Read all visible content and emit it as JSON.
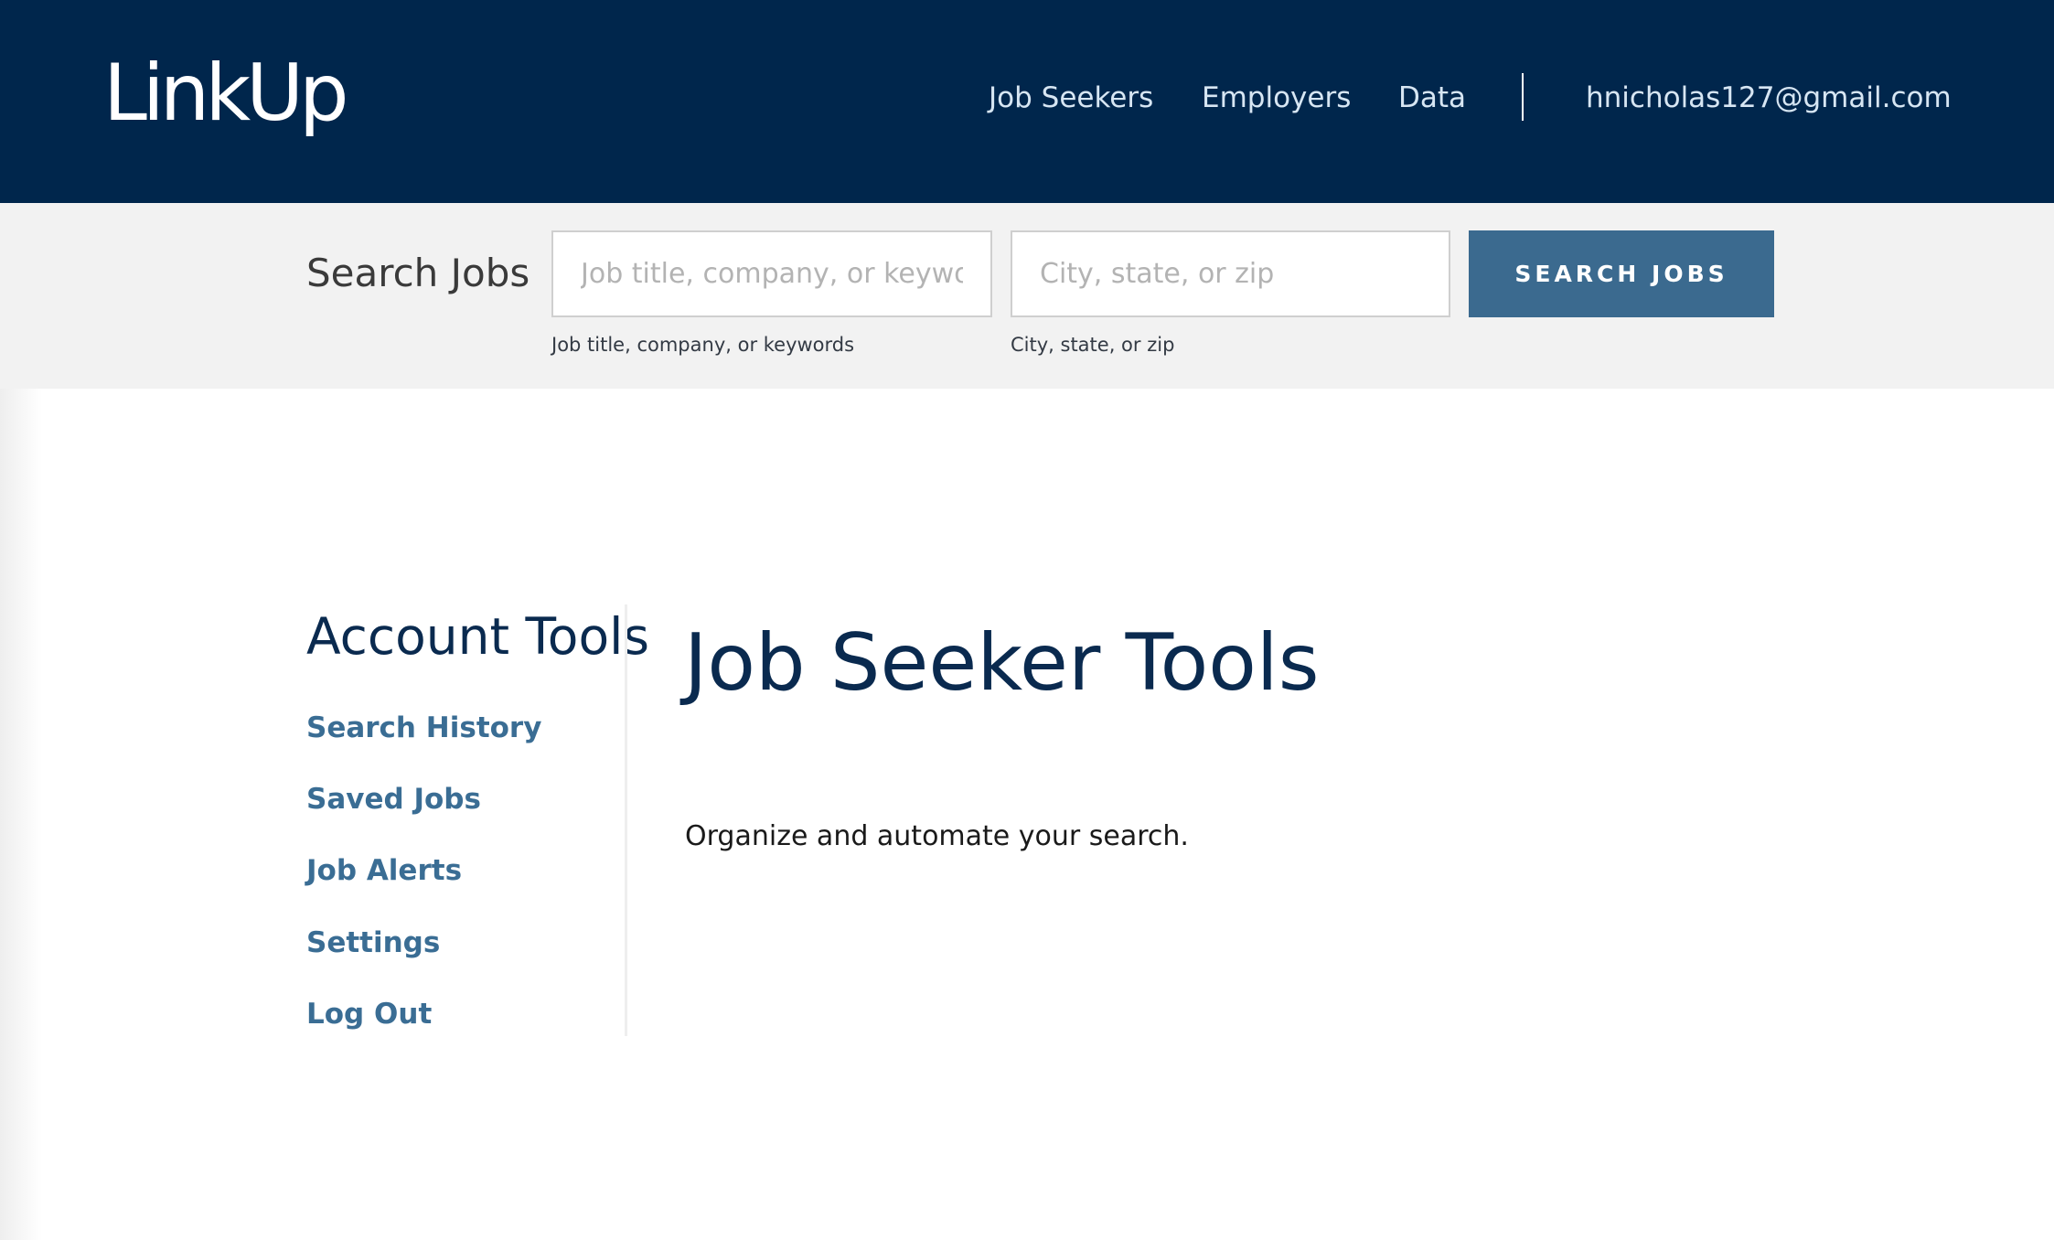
{
  "header": {
    "logo_text": "LinkUp",
    "nav": {
      "job_seekers": "Job Seekers",
      "employers": "Employers",
      "data": "Data"
    },
    "user_email": "hnicholas127@gmail.com"
  },
  "search": {
    "title": "Search Jobs",
    "keyword_field": {
      "placeholder": "Job title, company, or keywords",
      "caption": "Job title, company, or keywords"
    },
    "location_field": {
      "placeholder": "City, state, or zip",
      "caption": "City, state, or zip"
    },
    "button_label": "SEARCH JOBS"
  },
  "sidebar": {
    "title": "Account Tools",
    "items": [
      {
        "label": "Search History"
      },
      {
        "label": "Saved Jobs"
      },
      {
        "label": "Job Alerts"
      },
      {
        "label": "Settings"
      },
      {
        "label": "Log Out"
      }
    ]
  },
  "main": {
    "title": "Job Seeker Tools",
    "subtitle": "Organize and automate your search."
  },
  "colors": {
    "header_bg": "#00264c",
    "button_bg": "#3b6a8f",
    "link": "#3a6d94",
    "heading": "#0a2a4f"
  }
}
